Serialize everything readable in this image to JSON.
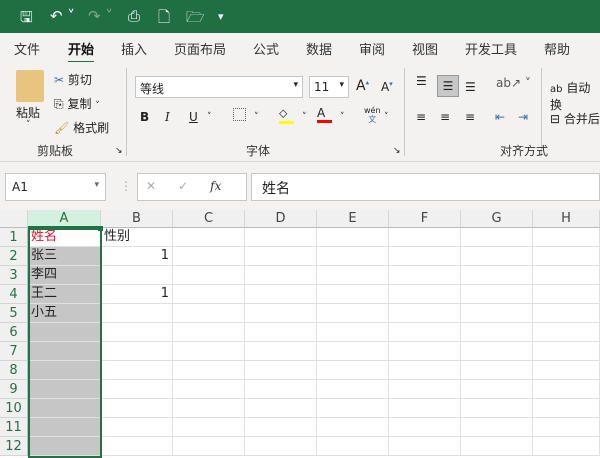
{
  "qat": {
    "icons": [
      "save-icon",
      "undo-icon",
      "redo-icon",
      "print-preview-icon",
      "new-file-icon",
      "open-folder-icon",
      "customize-icon"
    ]
  },
  "tabs": [
    "文件",
    "开始",
    "插入",
    "页面布局",
    "公式",
    "数据",
    "审阅",
    "视图",
    "开发工具",
    "帮助"
  ],
  "active_tab": "开始",
  "ribbon": {
    "clipboard": {
      "paste": "粘贴",
      "cut": "剪切",
      "copy": "复制",
      "format_painter": "格式刷",
      "label": "剪贴板"
    },
    "font": {
      "name": "等线",
      "size": "11",
      "bold": "B",
      "italic": "I",
      "underline": "U",
      "label": "字体",
      "highlight_color": "#ffff00",
      "font_color": "#ff0000",
      "phonetic": "wén"
    },
    "alignment": {
      "wrap": "自动换",
      "merge": "合并后",
      "label": "对齐方式"
    }
  },
  "formula_bar": {
    "name_box": "A1",
    "fx": "fx",
    "value": "姓名"
  },
  "sheet": {
    "columns": [
      "A",
      "B",
      "C",
      "D",
      "E",
      "F",
      "G",
      "H"
    ],
    "rows": [
      "1",
      "2",
      "3",
      "4",
      "5",
      "6",
      "7",
      "8",
      "9",
      "10",
      "11",
      "12"
    ],
    "cells": [
      [
        "姓名",
        "性别"
      ],
      [
        "张三",
        "1"
      ],
      [
        "李四",
        ""
      ],
      [
        "王二",
        "1"
      ],
      [
        "小五",
        ""
      ]
    ],
    "header_color": "#e81123",
    "selection_color": "#217346"
  }
}
